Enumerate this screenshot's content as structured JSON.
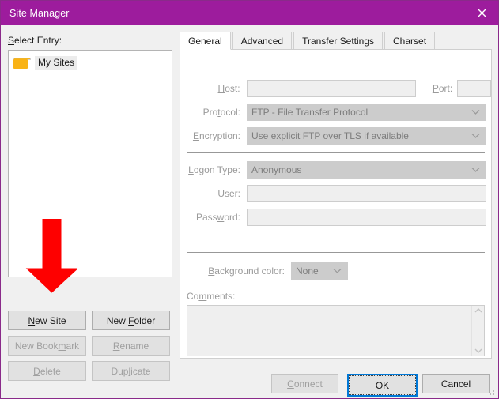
{
  "window": {
    "title": "Site Manager",
    "titlebar_color": "#9d1c9d",
    "close_icon": "close-icon"
  },
  "left_panel": {
    "label": "Select Entry:",
    "tree": {
      "items": [
        {
          "label": "My Sites",
          "icon": "folder-icon",
          "selected": true
        }
      ]
    },
    "buttons": [
      {
        "name": "new-site",
        "label": "New Site",
        "accel": "N",
        "enabled": true
      },
      {
        "name": "new-folder",
        "label": "New Folder",
        "accel": "F",
        "enabled": true
      },
      {
        "name": "new-bookmark",
        "label": "New Bookmark",
        "accel": "m",
        "enabled": false
      },
      {
        "name": "rename",
        "label": "Rename",
        "accel": "R",
        "enabled": false
      },
      {
        "name": "delete",
        "label": "Delete",
        "accel": "D",
        "enabled": false
      },
      {
        "name": "duplicate",
        "label": "Duplicate",
        "accel": "l",
        "enabled": false
      }
    ]
  },
  "tabs": [
    {
      "label": "General",
      "active": true
    },
    {
      "label": "Advanced",
      "active": false
    },
    {
      "label": "Transfer Settings",
      "active": false
    },
    {
      "label": "Charset",
      "active": false
    }
  ],
  "general": {
    "host": {
      "label": "Host:",
      "value": "",
      "placeholder": "",
      "enabled": false
    },
    "port": {
      "label": "Port:",
      "value": "",
      "placeholder": "",
      "enabled": false
    },
    "protocol": {
      "label": "Protocol:",
      "value": "FTP - File Transfer Protocol",
      "enabled": false
    },
    "encryption": {
      "label": "Encryption:",
      "value": "Use explicit FTP over TLS if available",
      "enabled": false
    },
    "logon_type": {
      "label": "Logon Type:",
      "value": "Anonymous",
      "enabled": false
    },
    "user": {
      "label": "User:",
      "value": "",
      "enabled": false
    },
    "password": {
      "label": "Password:",
      "value": "",
      "enabled": false
    },
    "background_color": {
      "label": "Background color:",
      "value": "None",
      "enabled": false
    },
    "comments": {
      "label": "Comments:",
      "value": "",
      "enabled": false
    }
  },
  "footer": {
    "connect": {
      "label": "Connect",
      "accel": "C",
      "enabled": false
    },
    "ok": {
      "label": "OK",
      "accel": "O",
      "enabled": true,
      "focused": true,
      "focus_color": "#0078d7"
    },
    "cancel": {
      "label": "Cancel",
      "enabled": true
    }
  },
  "annotation": {
    "arrow": {
      "name": "red-arrow-annotation",
      "color": "#fe0000",
      "points_to": "New Site"
    }
  }
}
